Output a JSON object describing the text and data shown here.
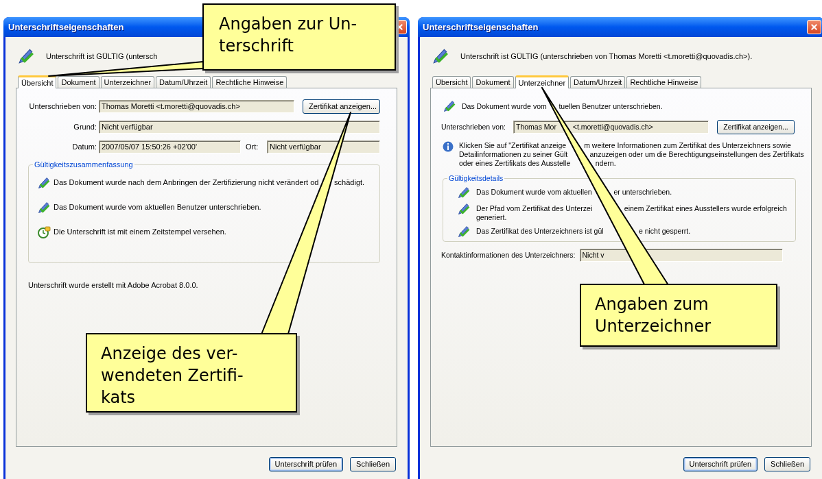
{
  "callouts": [
    {
      "lines": [
        "Angaben zur Un-",
        "terschrift"
      ]
    },
    {
      "lines": [
        "Anzeige des ver-",
        "wendeten Zertifi-",
        "kats"
      ]
    },
    {
      "lines": [
        "Angaben zum",
        "Unterzeichner"
      ]
    }
  ],
  "dialogs": [
    {
      "title": "Unterschriftseigenschaften",
      "status": [
        "Unterschrift ist GÜLTIG (untersch"
      ],
      "tabs": [
        {
          "label": "Übersicht",
          "selected": true
        },
        {
          "label": "Dokument",
          "selected": false
        },
        {
          "label": "Unterzeichner",
          "selected": false
        },
        {
          "label": "Datum/Uhrzeit",
          "selected": false
        },
        {
          "label": "Rechtliche Hinweise",
          "selected": false
        }
      ],
      "panel": {
        "kind": "overview",
        "signed_by": {
          "label": "Unterschrieben von:",
          "value": [
            "Thomas Moretti <t.moretti@quovadis.ch>"
          ],
          "button": "Zertifikat anzeigen..."
        },
        "reason": {
          "label": "Grund:",
          "value": "Nicht verfügbar"
        },
        "date": {
          "label": "Datum:",
          "value": "2007/05/07 15:50:26 +02'00'"
        },
        "place": {
          "label": "Ort:",
          "value": "Nicht verfügbar"
        },
        "group": {
          "title": "Gültigkeitszusammenfassung",
          "items": [
            {
              "kind": "valid",
              "lines": [
                [
                  "Das Dokument wurde nach dem Anbringen der Zertifizierung nicht verändert od",
                  "schädigt."
                ]
              ]
            },
            {
              "kind": "valid",
              "lines": [
                [
                  "Das Dokument wurde vom aktuellen Benutzer unterschrieben."
                ]
              ]
            },
            {
              "kind": "timestamp",
              "lines": [
                [
                  "Die Unterschrift ist mit einem Zeitstempel versehen."
                ]
              ]
            }
          ]
        },
        "footer": "Unterschrift wurde erstellt mit Adobe Acrobat 8.0.0."
      },
      "buttons": [
        {
          "label": "Unterschrift prüfen",
          "default": true
        },
        {
          "label": "Schließen",
          "default": false
        }
      ]
    },
    {
      "title": "Unterschriftseigenschaften",
      "status": [
        "Unterschrift ist GÜLTIG (unterschrieben von Thomas Moretti <t.moretti@quovadis.ch>)."
      ],
      "tabs": [
        {
          "label": "Übersicht",
          "selected": false
        },
        {
          "label": "Dokument",
          "selected": false
        },
        {
          "label": "Unterzeichner",
          "selected": true
        },
        {
          "label": "Datum/Uhrzeit",
          "selected": false
        },
        {
          "label": "Rechtliche Hinweise",
          "selected": false
        }
      ],
      "panel": {
        "kind": "signer",
        "notice": {
          "kind": "valid",
          "lines": [
            [
              "Das Dokument wurde vom",
              "tuellen Benutzer unterschrieben."
            ]
          ]
        },
        "signed_by": {
          "label": "Unterschrieben von:",
          "value": [
            "Thomas Mor",
            "<t.moretti@quovadis.ch>"
          ],
          "button": "Zertifikat anzeigen..."
        },
        "info": {
          "lines": [
            [
              "Klicken Sie auf \"Zertifikat anzeige",
              "m weitere Informationen zum Zertifikat des Unterzeichners sowie"
            ],
            [
              "Detailinformationen zu seiner Gült",
              "anzuzeigen oder um die Berechtigungseinstellungen des Zertifikats"
            ],
            [
              "oder eines Zertifikats des Ausstelle",
              "ndern."
            ]
          ]
        },
        "group": {
          "title": "Gültigkeitsdetails",
          "items": [
            {
              "kind": "valid",
              "lines": [
                [
                  "Das Dokument wurde vom aktuellen",
                  "er unterschrieben."
                ]
              ]
            },
            {
              "kind": "valid",
              "lines": [
                [
                  "Der Pfad vom Zertifikat des Unterzei",
                  "einem Zertifikat eines Ausstellers wurde erfolgreich"
                ],
                [
                  "generiert."
                ]
              ]
            },
            {
              "kind": "valid",
              "lines": [
                [
                  "Das Zertifikat des Unterzeichners ist gül",
                  "e nicht gesperrt."
                ]
              ]
            }
          ]
        },
        "contact": {
          "label": "Kontaktinformationen des Unterzeichners:",
          "value": "Nicht v"
        }
      },
      "buttons": [
        {
          "label": "Unterschrift prüfen",
          "default": true
        },
        {
          "label": "Schließen",
          "default": false
        }
      ]
    }
  ]
}
